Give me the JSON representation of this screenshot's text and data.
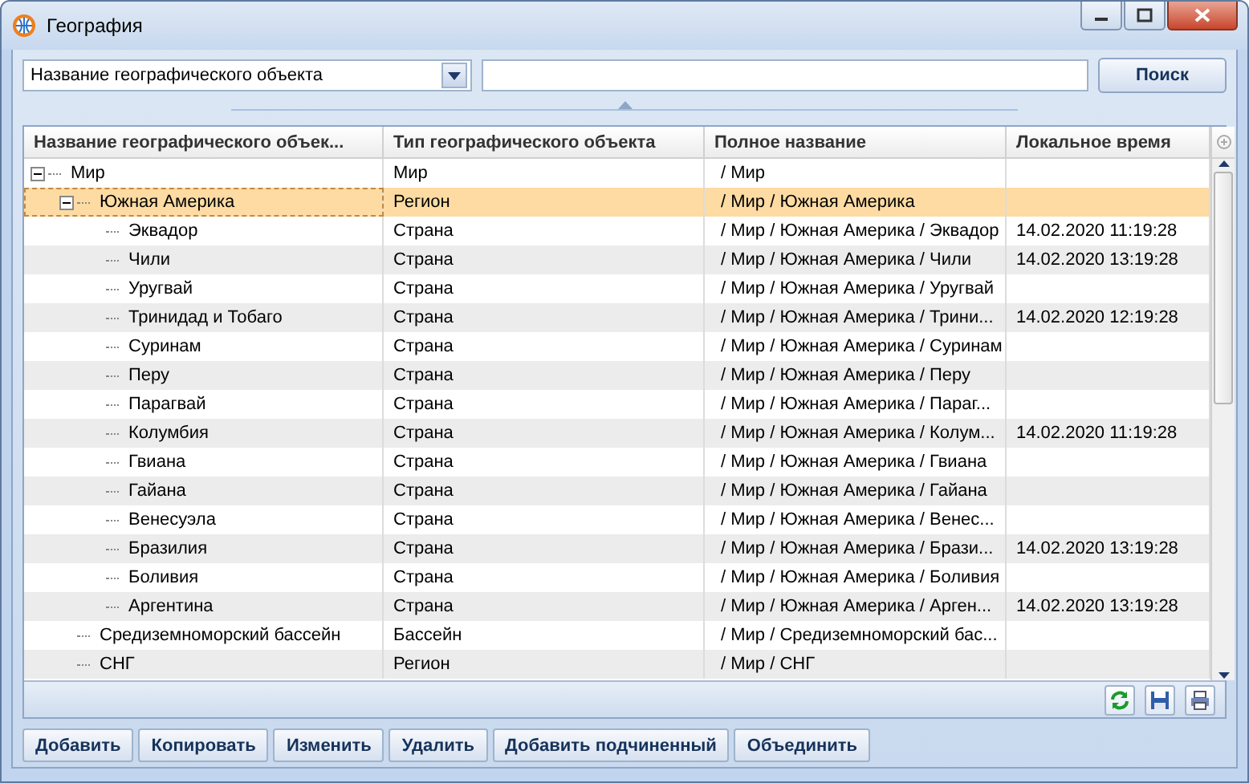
{
  "window": {
    "title": "География"
  },
  "search": {
    "field_selector": "Название географического объекта",
    "button": "Поиск"
  },
  "table": {
    "columns": [
      "Название географического объек...",
      "Тип географического объекта",
      "Полное название",
      "Локальное время"
    ],
    "rows": [
      {
        "name": "Мир",
        "type": "Мир",
        "full_name": "/ Мир",
        "expanded": true,
        "selected": false,
        "children": [
          {
            "name": "Южная Америка",
            "type": "Регион",
            "full_name": "/ Мир / Южная Америка",
            "expanded": true,
            "selected": true,
            "children": [
              {
                "name": "Эквадор",
                "type": "Страна",
                "full_name": "/ Мир / Южная Америка / Эквадор",
                "local_time": "14.02.2020 11:19:28",
                "selected": false
              },
              {
                "name": "Чили",
                "type": "Страна",
                "full_name": "/ Мир / Южная Америка / Чили",
                "local_time": "14.02.2020 13:19:28",
                "selected": false
              },
              {
                "name": "Уругвай",
                "type": "Страна",
                "full_name": "/ Мир / Южная Америка / Уругвай",
                "selected": false
              },
              {
                "name": "Тринидад и Тобаго",
                "type": "Страна",
                "full_name": "/ Мир / Южная Америка / Трини...",
                "local_time": "14.02.2020 12:19:28",
                "selected": false
              },
              {
                "name": "Суринам",
                "type": "Страна",
                "full_name": "/ Мир / Южная Америка / Суринам",
                "selected": false
              },
              {
                "name": "Перу",
                "type": "Страна",
                "full_name": "/ Мир / Южная Америка / Перу",
                "selected": false
              },
              {
                "name": "Парагвай",
                "type": "Страна",
                "full_name": "/ Мир / Южная Америка / Параг...",
                "selected": false
              },
              {
                "name": "Колумбия",
                "type": "Страна",
                "full_name": "/ Мир / Южная Америка / Колум...",
                "local_time": "14.02.2020 11:19:28",
                "selected": false
              },
              {
                "name": "Гвиана",
                "type": "Страна",
                "full_name": "/ Мир / Южная Америка / Гвиана",
                "selected": false
              },
              {
                "name": "Гайана",
                "type": "Страна",
                "full_name": "/ Мир / Южная Америка / Гайана",
                "selected": false
              },
              {
                "name": "Венесуэла",
                "type": "Страна",
                "full_name": "/ Мир / Южная Америка / Венес...",
                "selected": false
              },
              {
                "name": "Бразилия",
                "type": "Страна",
                "full_name": "/ Мир / Южная Америка / Брази...",
                "local_time": "14.02.2020 13:19:28",
                "selected": false
              },
              {
                "name": "Боливия",
                "type": "Страна",
                "full_name": "/ Мир / Южная Америка / Боливия",
                "selected": false
              },
              {
                "name": "Аргентина",
                "type": "Страна",
                "full_name": "/ Мир / Южная Америка / Арген...",
                "local_time": "14.02.2020 13:19:28",
                "selected": false
              }
            ]
          },
          {
            "name": "Средиземноморский бассейн",
            "type": "Бассейн",
            "full_name": "/ Мир / Средиземноморский бас...",
            "selected": false
          },
          {
            "name": "СНГ",
            "type": "Регион",
            "full_name": "/ Мир / СНГ",
            "selected": false
          }
        ]
      }
    ]
  },
  "actions": [
    "Добавить",
    "Копировать",
    "Изменить",
    "Удалить",
    "Добавить подчиненный",
    "Объединить"
  ]
}
